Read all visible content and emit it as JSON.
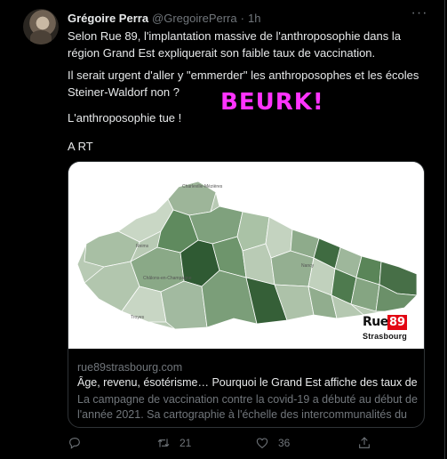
{
  "tweet": {
    "author_name": "Grégoire Perra",
    "author_handle": "@GregoirePerra",
    "separator": "·",
    "time": "1h",
    "more_label": "···",
    "line1": "Selon Rue 89, l'implantation massive de l'anthroposophie dans la région Grand Est expliquerait son faible taux de vaccination.",
    "line2": "Il serait urgent d'aller y \"emmerder\" les anthroposophes et les écoles Steiner-Waldorf non ?",
    "line3": "L'anthroposophie tue !",
    "line4": "A RT",
    "overlay_text": "BEURK!"
  },
  "card": {
    "domain": "rue89strasbourg.com",
    "title": "Âge, revenu, ésotérisme… Pourquoi le Grand Est affiche des taux de v…",
    "description": "La campagne de vaccination contre la covid-19 a débuté au début de l'année 2021. Sa cartographie à l'échelle des intercommunalités du …",
    "logo_word": "Rue",
    "logo_number": "89",
    "logo_city": "Strasbourg",
    "map_labels": [
      "Charleville-Mézières",
      "Reims",
      "Châlons-en-Champagne",
      "Troyes",
      "Nancy"
    ]
  },
  "actions": {
    "reply_count": "",
    "retweet_count": "21",
    "like_count": "36"
  },
  "colors": {
    "background": "#000000",
    "text_primary": "#e7e9ea",
    "text_secondary": "#71767b",
    "overlay": "#ff33ff",
    "map_dark": "#2f5a33",
    "map_light": "#c3d3bf",
    "logo_red": "#e30613"
  },
  "icons": [
    "more-icon",
    "reply-icon",
    "retweet-icon",
    "like-icon",
    "share-icon"
  ]
}
